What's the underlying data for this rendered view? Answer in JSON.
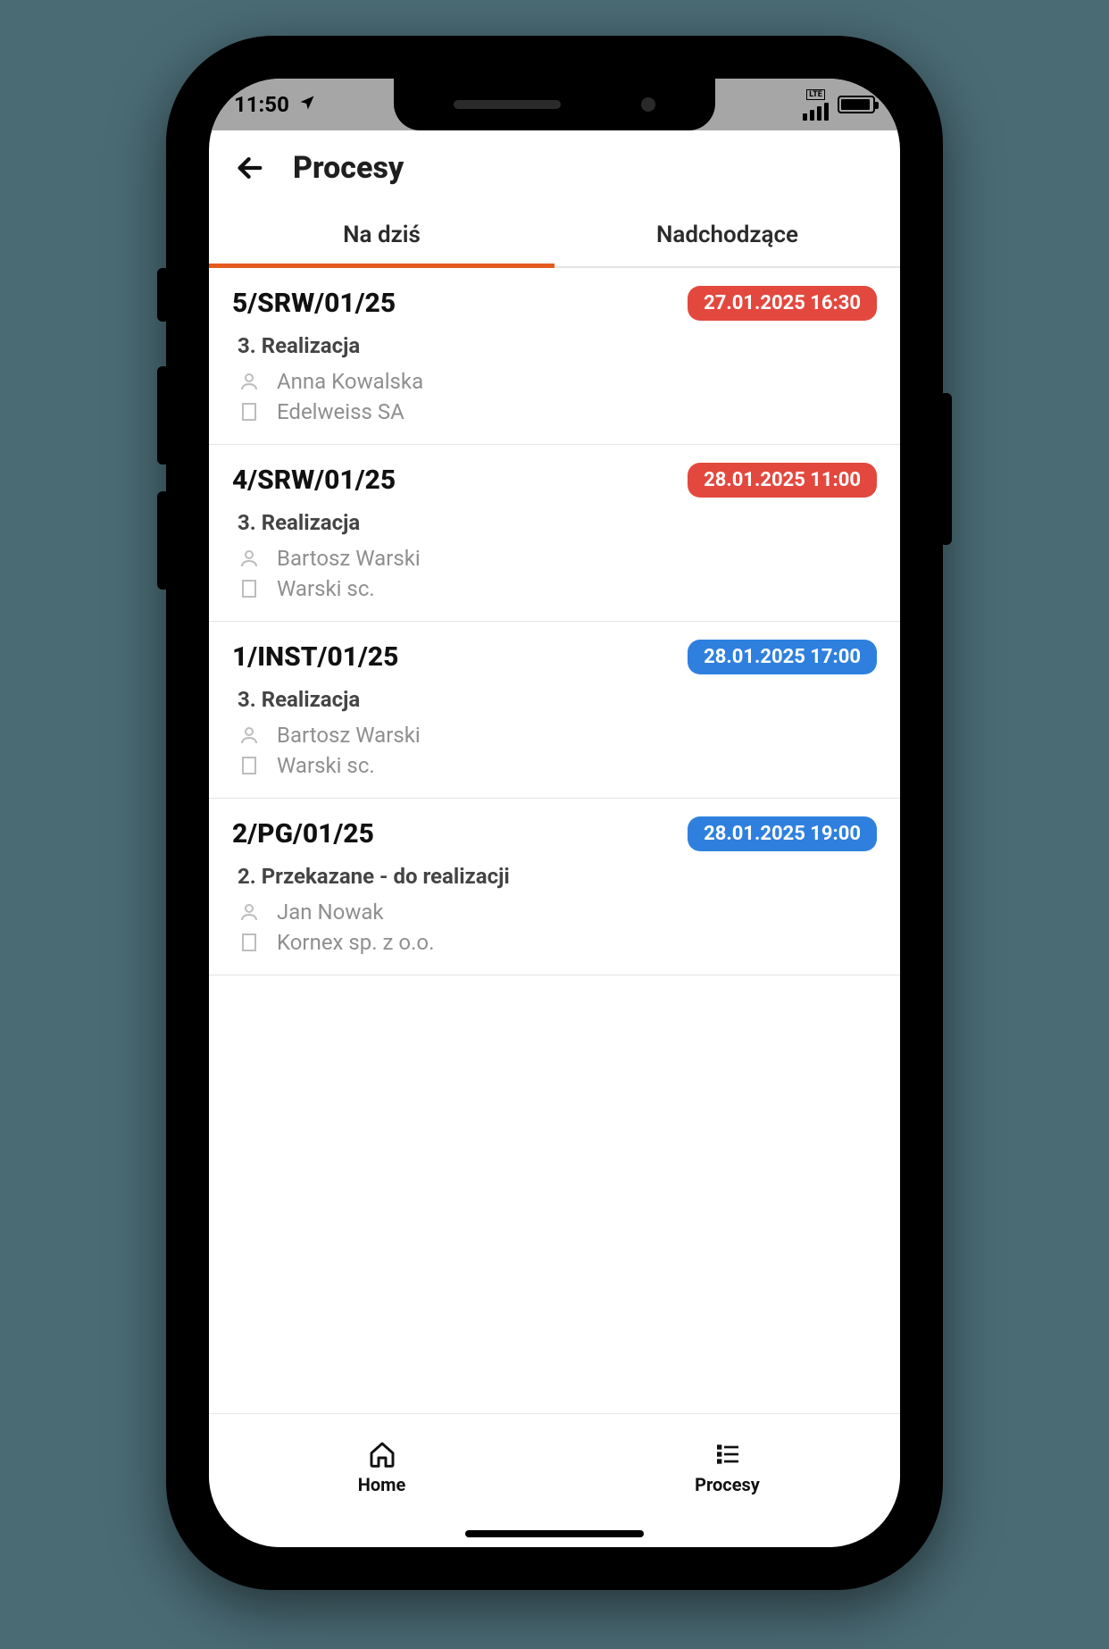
{
  "status_bar": {
    "time": "11:50",
    "network_label": "LTE"
  },
  "header": {
    "title": "Procesy"
  },
  "tabs": [
    {
      "label": "Na dziś",
      "active": true
    },
    {
      "label": "Nadchodzące",
      "active": false
    }
  ],
  "items": [
    {
      "id": "5/SRW/01/25",
      "datetime": "27.01.2025 16:30",
      "badge_color": "red",
      "status": "3. Realizacja",
      "person": "Anna Kowalska",
      "company": "Edelweiss SA"
    },
    {
      "id": "4/SRW/01/25",
      "datetime": "28.01.2025 11:00",
      "badge_color": "red",
      "status": "3. Realizacja",
      "person": "Bartosz Warski",
      "company": "Warski sc."
    },
    {
      "id": "1/INST/01/25",
      "datetime": "28.01.2025 17:00",
      "badge_color": "blue",
      "status": "3. Realizacja",
      "person": "Bartosz Warski",
      "company": "Warski sc."
    },
    {
      "id": "2/PG/01/25",
      "datetime": "28.01.2025 19:00",
      "badge_color": "blue",
      "status": "2. Przekazane - do realizacji",
      "person": "Jan Nowak",
      "company": "Kornex sp. z o.o."
    }
  ],
  "bottom_nav": [
    {
      "label": "Home",
      "icon": "home"
    },
    {
      "label": "Procesy",
      "icon": "list"
    }
  ]
}
